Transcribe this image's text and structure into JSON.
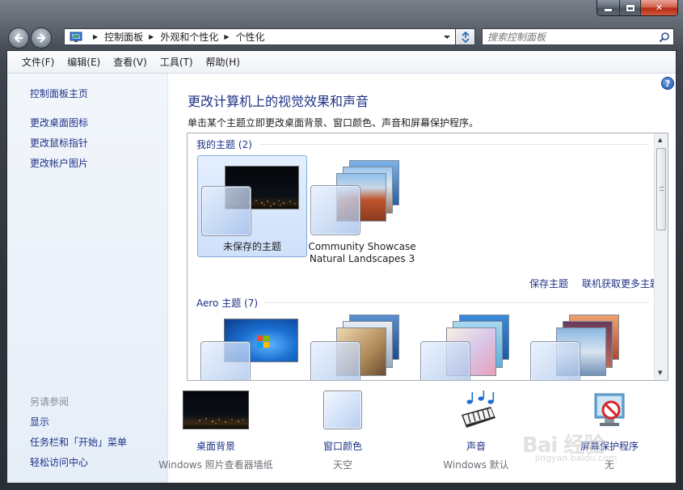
{
  "window": {
    "minimize_label": "",
    "close_label": "✕"
  },
  "address": {
    "crumbs": [
      "控制面板",
      "外观和个性化",
      "个性化"
    ]
  },
  "search": {
    "placeholder": "搜索控制面板"
  },
  "menubar": {
    "items": [
      "文件(F)",
      "编辑(E)",
      "查看(V)",
      "工具(T)",
      "帮助(H)"
    ]
  },
  "sidebar": {
    "links": [
      "控制面板主页",
      "更改桌面图标",
      "更改鼠标指针",
      "更改帐户图片"
    ],
    "see_also_title": "另请参阅",
    "see_also": [
      "显示",
      "任务栏和「开始」菜单",
      "轻松访问中心"
    ]
  },
  "main": {
    "help_label": "?",
    "title": "更改计算机上的视觉效果和声音",
    "description": "单击某个主题立即更改桌面背景、窗口颜色、声音和屏幕保护程序。",
    "my_themes": {
      "heading": "我的主题 (2)",
      "themes": [
        {
          "name": "未保存的主题"
        },
        {
          "name_line1": "Community Showcase",
          "name_line2": "Natural Landscapes 3"
        }
      ]
    },
    "links": [
      "保存主题",
      "联机获取更多主题"
    ],
    "aero_themes": {
      "heading": "Aero 主题 (7)"
    },
    "options": [
      {
        "label": "桌面背景",
        "sub": "Windows 照片查看器墙纸"
      },
      {
        "label": "窗口颜色",
        "sub": "天空"
      },
      {
        "label": "声音",
        "sub": "Windows 默认"
      },
      {
        "label": "屏幕保护程序",
        "sub": "无"
      }
    ]
  },
  "watermark": {
    "text": "Bai 经验",
    "sub": "jingyan.baidu.com"
  },
  "colors": {
    "link": "#1e3287",
    "sidebar_bg": "#e6eef8",
    "selected_tile": "#cfe0fa",
    "frame": "#3e444d",
    "close_button": "#b62a13"
  }
}
